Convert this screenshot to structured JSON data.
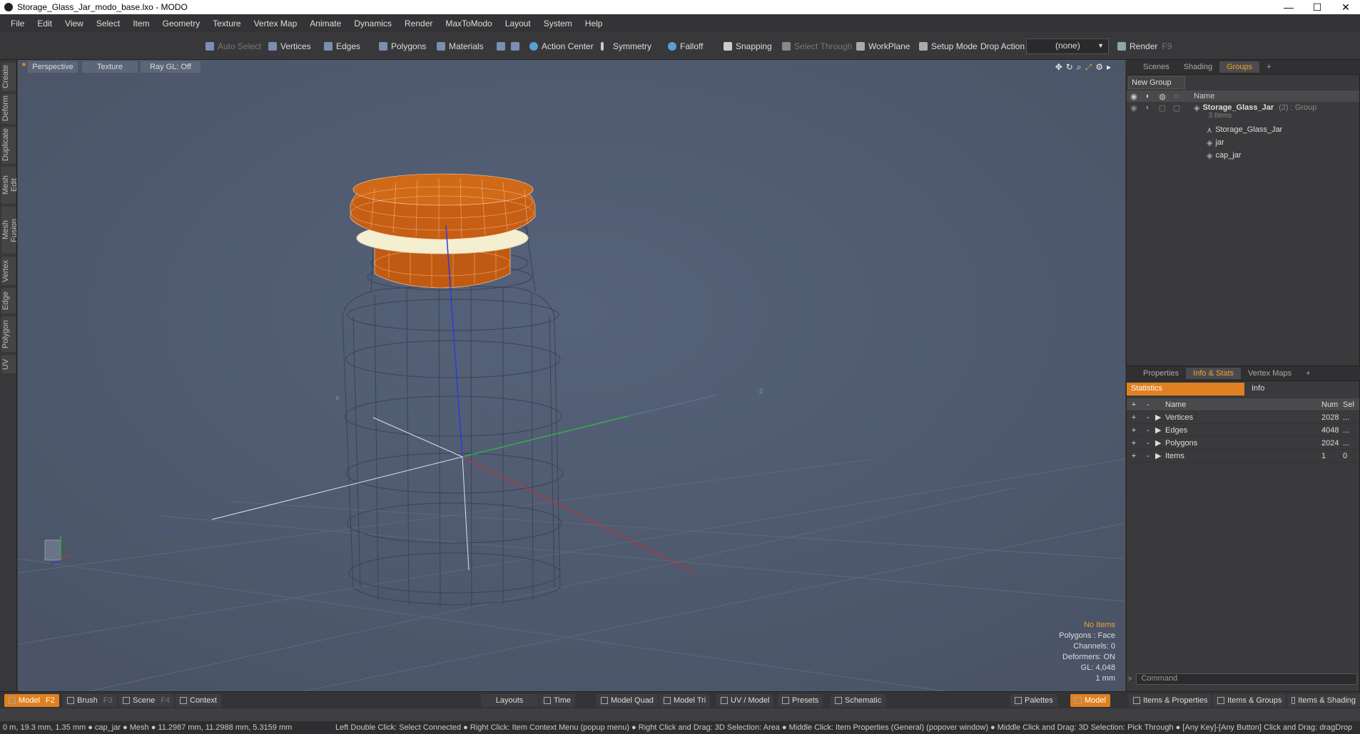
{
  "window": {
    "title": "Storage_Glass_Jar_modo_base.lxo - MODO",
    "minimize": "—",
    "maximize": "☐",
    "close": "✕"
  },
  "menu": [
    "File",
    "Edit",
    "View",
    "Select",
    "Item",
    "Geometry",
    "Texture",
    "Vertex Map",
    "Animate",
    "Dynamics",
    "Render",
    "MaxToModo",
    "Layout",
    "System",
    "Help"
  ],
  "toolbar": {
    "auto_select": "Auto Select",
    "vertices": "Vertices",
    "edges": "Edges",
    "polygons": "Polygons",
    "materials": "Materials",
    "action_center": "Action Center",
    "symmetry": "Symmetry",
    "falloff": "Falloff",
    "snapping": "Snapping",
    "select_through": "Select Through",
    "workplane": "WorkPlane",
    "setup_mode": "Setup Mode",
    "drop_action": "Drop Action",
    "drop_value": "(none)",
    "render": "Render",
    "render_key": "F9"
  },
  "left_tabs": [
    "Create",
    "Deform",
    "Duplicate",
    "Mesh Edit",
    "Mesh Fusion",
    "Vertex",
    "Edge",
    "Polygon",
    "UV"
  ],
  "viewport": {
    "view": "Perspective",
    "shading": "Texture",
    "raygl": "Ray GL: Off",
    "info": {
      "items": "No Items",
      "polygons": "Polygons : Face",
      "channels": "Channels: 0",
      "deformers": "Deformers: ON",
      "gl": "GL: 4,048",
      "unit": "1 mm"
    },
    "axis_x_label": "X",
    "axis_z_label": "-Z"
  },
  "scene_panel": {
    "tabs": [
      "Scenes",
      "Shading",
      "Groups"
    ],
    "active_tab": "Groups",
    "new_group": "New Group",
    "col_name": "Name",
    "group_name": "Storage_Glass_Jar",
    "group_suffix": "(2) : Group",
    "group_count": "3 Items",
    "children": [
      "Storage_Glass_Jar",
      "jar",
      "cap_jar"
    ]
  },
  "props_panel": {
    "tabs": [
      "Properties",
      "Info & Stats",
      "Vertex Maps"
    ],
    "active_tab": "Info & Stats",
    "sub_tabs": [
      "Statistics",
      "Info"
    ],
    "headers": {
      "name": "Name",
      "num": "Num",
      "sel": "Sel"
    },
    "rows": [
      {
        "name": "Vertices",
        "num": "2028",
        "sel": "..."
      },
      {
        "name": "Edges",
        "num": "4048",
        "sel": "..."
      },
      {
        "name": "Polygons",
        "num": "2024",
        "sel": "..."
      },
      {
        "name": "Items",
        "num": "1",
        "sel": "0"
      }
    ],
    "command_placeholder": "Command"
  },
  "bottom": {
    "model": "Model",
    "model_key": "F2",
    "brush": "Brush",
    "brush_key": "F3",
    "scene": "Scene",
    "scene_key": "F4",
    "context": "Context",
    "layouts": "Layouts",
    "time": "Time",
    "model_quad": "Model Quad",
    "model_tri": "Model Tri",
    "uv_model": "UV / Model",
    "presets": "Presets",
    "schematic": "Schematic",
    "palettes": "Palettes",
    "model_right": "Model",
    "items_properties": "Items & Properties",
    "items_groups": "Items & Groups",
    "items_shading": "Items & Shading"
  },
  "status": {
    "left": "0 m, 19.3 mm, 1.35 mm ● cap_jar ● Mesh ● 11.2987 mm, 11.2988 mm, 5.3159 mm",
    "hints": "Left Double Click: Select Connected ● Right Click: Item Context Menu (popup menu) ● Right Click and Drag: 3D Selection: Area ● Middle Click: Item Properties (General) (popover window) ● Middle Click and Drag: 3D Selection: Pick Through ● [Any Key]-[Any Button] Click and Drag: dragDrop"
  }
}
